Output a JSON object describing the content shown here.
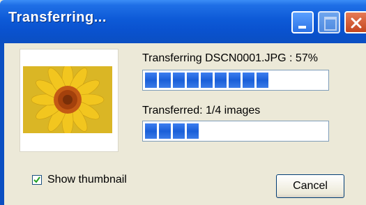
{
  "window": {
    "title": "Transferring...",
    "controls": {
      "minimize": "minimize-icon",
      "maximize": "maximize-icon",
      "close": "close-icon"
    }
  },
  "transfer": {
    "file_status": "Transferring DSCN0001.JPG : 57%",
    "file_progress": 0.57,
    "overall_status": "Transferred: 1/4 images",
    "overall_progress": 0.25
  },
  "thumbnail": {
    "icon": "sunflower-thumbnail"
  },
  "options": {
    "show_thumbnail_label": "Show thumbnail",
    "show_thumbnail_checked": true
  },
  "buttons": {
    "cancel_label": "Cancel"
  },
  "colors": {
    "titlebar": "#0b4fc2",
    "progress": "#1a5fd8",
    "background": "#ece9d8"
  }
}
